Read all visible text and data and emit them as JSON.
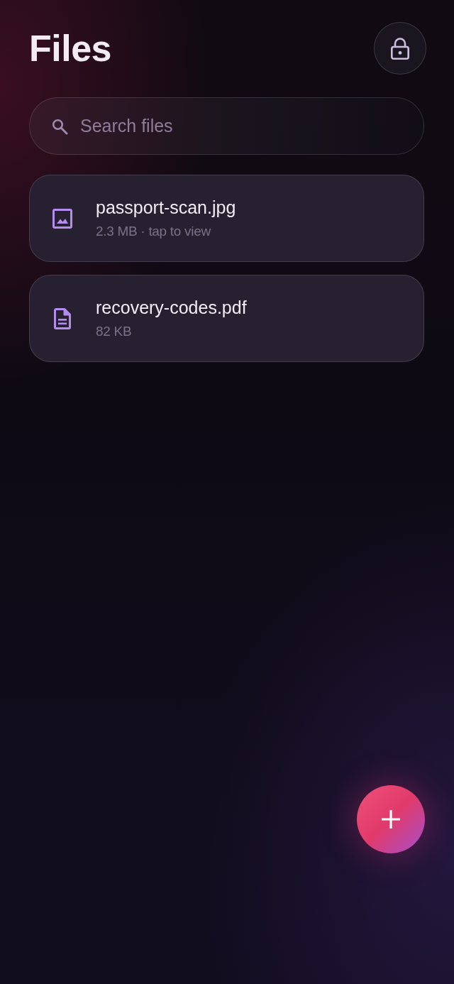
{
  "header": {
    "title": "Files"
  },
  "search": {
    "placeholder": "Search files"
  },
  "files": [
    {
      "kind": "image",
      "name": "passport-scan.jpg",
      "meta": "2.3 MB · tap to view"
    },
    {
      "kind": "document",
      "name": "recovery-codes.pdf",
      "meta": "82 KB"
    }
  ]
}
